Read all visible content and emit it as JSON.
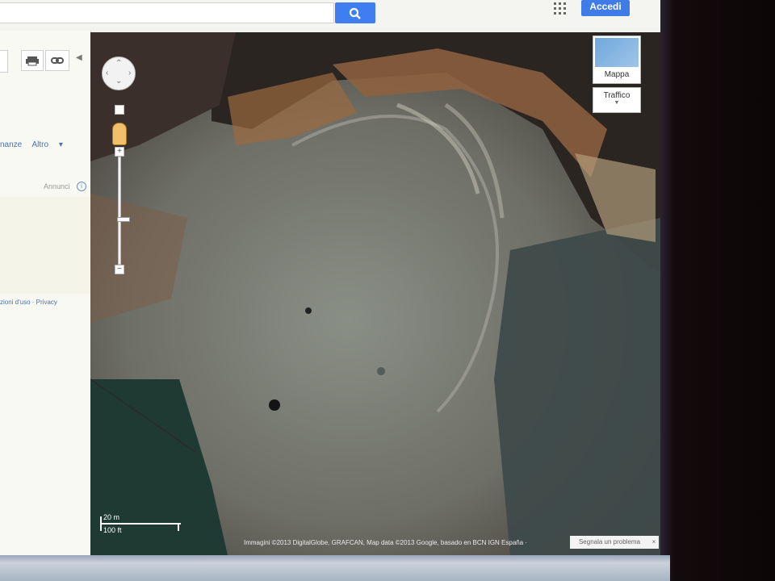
{
  "header": {
    "search_value": "",
    "signin_label": "Accedi"
  },
  "sidebar": {
    "nav_partial": "nanze",
    "more_label": "Altro",
    "ads_label": "Annunci",
    "footer_partial": "zioni d'uso · Privacy"
  },
  "map": {
    "map_type_label": "Mappa",
    "traffic_label": "Traffico",
    "scale_metric": "20 m",
    "scale_imperial": "100 ft",
    "attribution": "Immagini ©2013 DigitalGlobe, GRAFCAN, Map data ©2013 Google, basado en BCN IGN España ·",
    "report_label": "Segnala un problema",
    "report_close": "×"
  },
  "colors": {
    "accent_blue": "#3e7ef0",
    "link_blue": "#4a6fb5"
  }
}
